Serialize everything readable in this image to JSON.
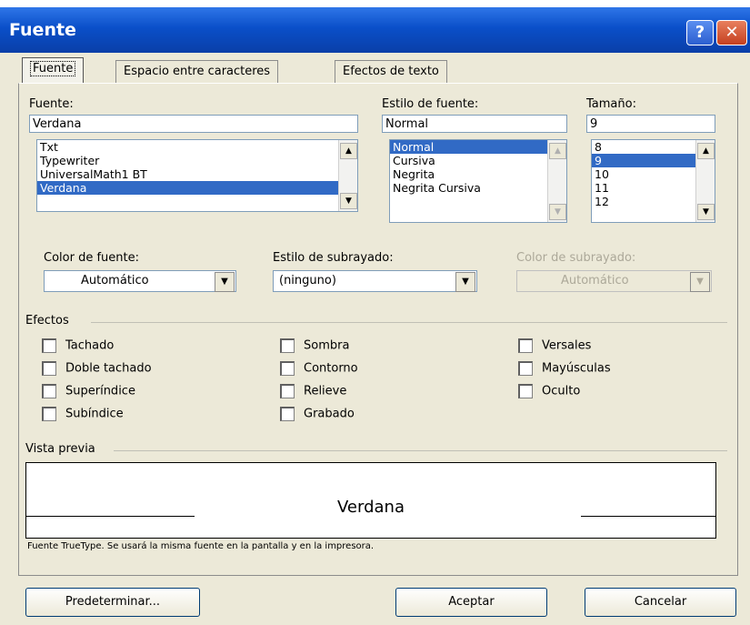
{
  "window": {
    "title": "Fuente",
    "help_glyph": "?",
    "close_glyph": "✕"
  },
  "tabs": [
    {
      "label": "Fuente"
    },
    {
      "label": "Espacio entre caracteres"
    },
    {
      "label": "Efectos de texto"
    }
  ],
  "font": {
    "label": "Fuente:",
    "value": "Verdana",
    "items": [
      "Txt",
      "Typewriter",
      "UniversalMath1 BT",
      "Verdana"
    ],
    "selected_index": 3
  },
  "style": {
    "label": "Estilo de fuente:",
    "value": "Normal",
    "items": [
      "Normal",
      "Cursiva",
      "Negrita",
      "Negrita Cursiva"
    ],
    "selected_index": 0
  },
  "size": {
    "label": "Tamaño:",
    "value": "9",
    "items": [
      "8",
      "9",
      "10",
      "11",
      "12"
    ],
    "selected_index": 1
  },
  "font_color": {
    "label": "Color de fuente:",
    "value": "Automático"
  },
  "underline_style": {
    "label": "Estilo de subrayado:",
    "value": "(ninguno)"
  },
  "underline_color": {
    "label": "Color de subrayado:",
    "value": "Automático"
  },
  "effects": {
    "label": "Efectos",
    "col1": [
      "Tachado",
      "Doble tachado",
      "Superíndice",
      "Subíndice"
    ],
    "col2": [
      "Sombra",
      "Contorno",
      "Relieve",
      "Grabado"
    ],
    "col3": [
      "Versales",
      "Mayúsculas",
      "Oculto"
    ]
  },
  "preview": {
    "label": "Vista previa",
    "sample": "Verdana",
    "note": "Fuente TrueType. Se usará la misma fuente en la pantalla y en la impresora."
  },
  "buttons": {
    "default": "Predeterminar...",
    "ok": "Aceptar",
    "cancel": "Cancelar"
  },
  "colors": {
    "title_bar": "#0a4fc9",
    "selection": "#316ac5",
    "dialog_bg": "#ece9d8"
  }
}
